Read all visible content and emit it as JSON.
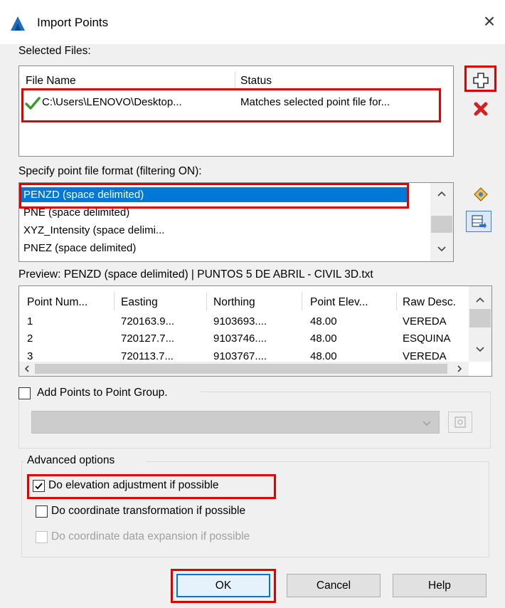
{
  "window": {
    "title": "Import Points"
  },
  "selected_files": {
    "label": "Selected Files:",
    "columns": [
      "File Name",
      "Status"
    ],
    "rows": [
      {
        "file_name": "C:\\Users\\LENOVO\\Desktop...",
        "status": "Matches selected point file for..."
      }
    ]
  },
  "format": {
    "label": "Specify point file format (filtering ON):",
    "items": [
      "PENZD (space delimited)",
      "PNE (space delimited)",
      "XYZ_Intensity (space delimi...",
      "PNEZ (space delimited)"
    ],
    "selected_index": 0
  },
  "preview": {
    "label": "Preview: PENZD (space delimited) | PUNTOS 5 DE ABRIL - CIVIL 3D.txt",
    "columns": [
      "Point Num...",
      "Easting",
      "Northing",
      "Point Elev...",
      "Raw Desc."
    ],
    "rows": [
      [
        "1",
        "720163.9...",
        "9103693....",
        "48.00",
        "VEREDA"
      ],
      [
        "2",
        "720127.7...",
        "9103746....",
        "48.00",
        "ESQUINA"
      ],
      [
        "3",
        "720113.7...",
        "9103767....",
        "48.00",
        "VEREDA"
      ]
    ]
  },
  "point_group": {
    "label": "Add Points to Point Group.",
    "checked": false
  },
  "advanced": {
    "title": "Advanced options",
    "options": [
      {
        "label": "Do elevation adjustment if possible",
        "checked": true,
        "enabled": true
      },
      {
        "label": "Do coordinate transformation if possible",
        "checked": false,
        "enabled": true
      },
      {
        "label": "Do coordinate data expansion if possible",
        "checked": false,
        "enabled": false
      }
    ]
  },
  "buttons": {
    "ok": "OK",
    "cancel": "Cancel",
    "help": "Help"
  },
  "colors": {
    "selection": "#0078d7",
    "highlight": "#e00000",
    "check_green": "#3a9a2a",
    "delete_red": "#d62020"
  }
}
